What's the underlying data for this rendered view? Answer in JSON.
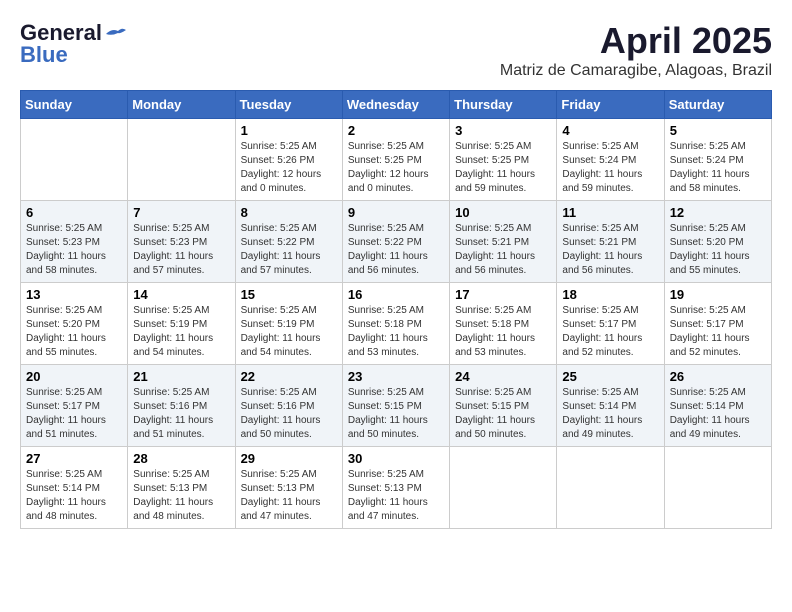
{
  "header": {
    "logo_line1": "General",
    "logo_line2": "Blue",
    "month": "April 2025",
    "location": "Matriz de Camaragibe, Alagoas, Brazil"
  },
  "weekdays": [
    "Sunday",
    "Monday",
    "Tuesday",
    "Wednesday",
    "Thursday",
    "Friday",
    "Saturday"
  ],
  "weeks": [
    [
      {
        "day": "",
        "info": ""
      },
      {
        "day": "",
        "info": ""
      },
      {
        "day": "1",
        "info": "Sunrise: 5:25 AM\nSunset: 5:26 PM\nDaylight: 12 hours\nand 0 minutes."
      },
      {
        "day": "2",
        "info": "Sunrise: 5:25 AM\nSunset: 5:25 PM\nDaylight: 12 hours\nand 0 minutes."
      },
      {
        "day": "3",
        "info": "Sunrise: 5:25 AM\nSunset: 5:25 PM\nDaylight: 11 hours\nand 59 minutes."
      },
      {
        "day": "4",
        "info": "Sunrise: 5:25 AM\nSunset: 5:24 PM\nDaylight: 11 hours\nand 59 minutes."
      },
      {
        "day": "5",
        "info": "Sunrise: 5:25 AM\nSunset: 5:24 PM\nDaylight: 11 hours\nand 58 minutes."
      }
    ],
    [
      {
        "day": "6",
        "info": "Sunrise: 5:25 AM\nSunset: 5:23 PM\nDaylight: 11 hours\nand 58 minutes."
      },
      {
        "day": "7",
        "info": "Sunrise: 5:25 AM\nSunset: 5:23 PM\nDaylight: 11 hours\nand 57 minutes."
      },
      {
        "day": "8",
        "info": "Sunrise: 5:25 AM\nSunset: 5:22 PM\nDaylight: 11 hours\nand 57 minutes."
      },
      {
        "day": "9",
        "info": "Sunrise: 5:25 AM\nSunset: 5:22 PM\nDaylight: 11 hours\nand 56 minutes."
      },
      {
        "day": "10",
        "info": "Sunrise: 5:25 AM\nSunset: 5:21 PM\nDaylight: 11 hours\nand 56 minutes."
      },
      {
        "day": "11",
        "info": "Sunrise: 5:25 AM\nSunset: 5:21 PM\nDaylight: 11 hours\nand 56 minutes."
      },
      {
        "day": "12",
        "info": "Sunrise: 5:25 AM\nSunset: 5:20 PM\nDaylight: 11 hours\nand 55 minutes."
      }
    ],
    [
      {
        "day": "13",
        "info": "Sunrise: 5:25 AM\nSunset: 5:20 PM\nDaylight: 11 hours\nand 55 minutes."
      },
      {
        "day": "14",
        "info": "Sunrise: 5:25 AM\nSunset: 5:19 PM\nDaylight: 11 hours\nand 54 minutes."
      },
      {
        "day": "15",
        "info": "Sunrise: 5:25 AM\nSunset: 5:19 PM\nDaylight: 11 hours\nand 54 minutes."
      },
      {
        "day": "16",
        "info": "Sunrise: 5:25 AM\nSunset: 5:18 PM\nDaylight: 11 hours\nand 53 minutes."
      },
      {
        "day": "17",
        "info": "Sunrise: 5:25 AM\nSunset: 5:18 PM\nDaylight: 11 hours\nand 53 minutes."
      },
      {
        "day": "18",
        "info": "Sunrise: 5:25 AM\nSunset: 5:17 PM\nDaylight: 11 hours\nand 52 minutes."
      },
      {
        "day": "19",
        "info": "Sunrise: 5:25 AM\nSunset: 5:17 PM\nDaylight: 11 hours\nand 52 minutes."
      }
    ],
    [
      {
        "day": "20",
        "info": "Sunrise: 5:25 AM\nSunset: 5:17 PM\nDaylight: 11 hours\nand 51 minutes."
      },
      {
        "day": "21",
        "info": "Sunrise: 5:25 AM\nSunset: 5:16 PM\nDaylight: 11 hours\nand 51 minutes."
      },
      {
        "day": "22",
        "info": "Sunrise: 5:25 AM\nSunset: 5:16 PM\nDaylight: 11 hours\nand 50 minutes."
      },
      {
        "day": "23",
        "info": "Sunrise: 5:25 AM\nSunset: 5:15 PM\nDaylight: 11 hours\nand 50 minutes."
      },
      {
        "day": "24",
        "info": "Sunrise: 5:25 AM\nSunset: 5:15 PM\nDaylight: 11 hours\nand 50 minutes."
      },
      {
        "day": "25",
        "info": "Sunrise: 5:25 AM\nSunset: 5:14 PM\nDaylight: 11 hours\nand 49 minutes."
      },
      {
        "day": "26",
        "info": "Sunrise: 5:25 AM\nSunset: 5:14 PM\nDaylight: 11 hours\nand 49 minutes."
      }
    ],
    [
      {
        "day": "27",
        "info": "Sunrise: 5:25 AM\nSunset: 5:14 PM\nDaylight: 11 hours\nand 48 minutes."
      },
      {
        "day": "28",
        "info": "Sunrise: 5:25 AM\nSunset: 5:13 PM\nDaylight: 11 hours\nand 48 minutes."
      },
      {
        "day": "29",
        "info": "Sunrise: 5:25 AM\nSunset: 5:13 PM\nDaylight: 11 hours\nand 47 minutes."
      },
      {
        "day": "30",
        "info": "Sunrise: 5:25 AM\nSunset: 5:13 PM\nDaylight: 11 hours\nand 47 minutes."
      },
      {
        "day": "",
        "info": ""
      },
      {
        "day": "",
        "info": ""
      },
      {
        "day": "",
        "info": ""
      }
    ]
  ]
}
